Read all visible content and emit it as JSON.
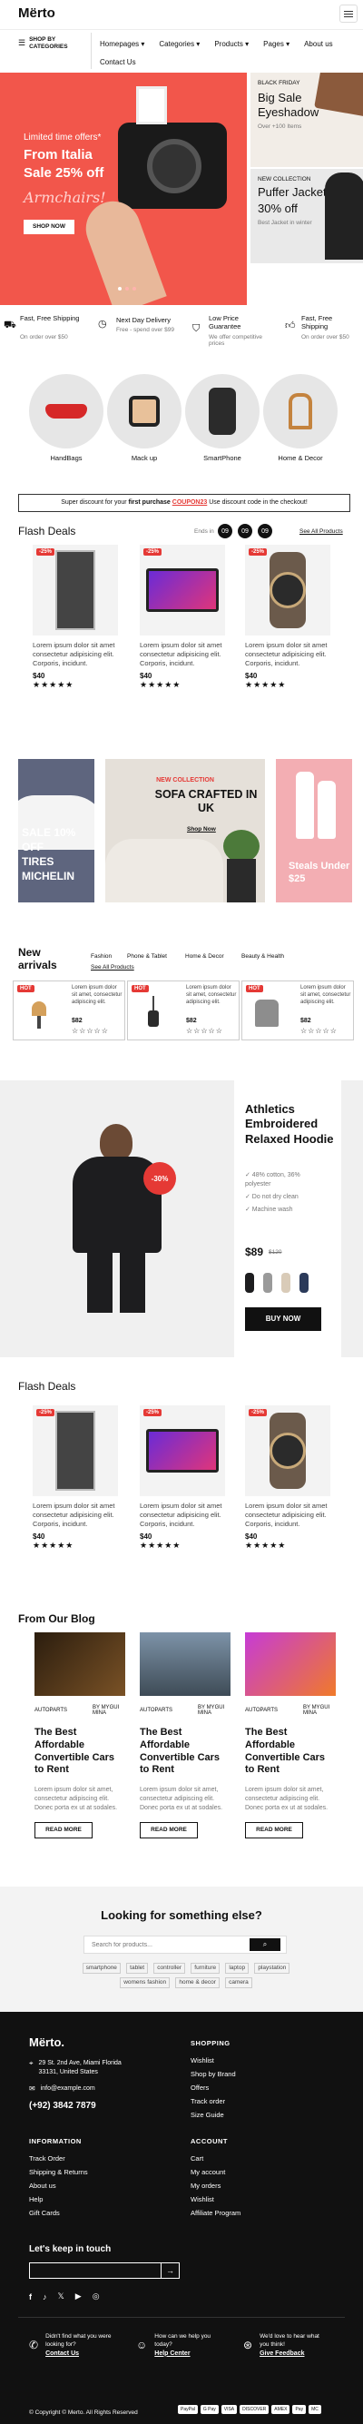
{
  "header": {
    "logo": "Mërto",
    "menu_icon": "hamburger-icon",
    "shop_by": "SHOP BY\nCATEGORIES",
    "nav": [
      "Homepages",
      "Categories",
      "Products",
      "Pages",
      "About us",
      "Contact Us"
    ]
  },
  "hero": {
    "eyebrow": "Limited time offers*",
    "title_line1": "From Italia",
    "title_line2": "Sale 25% off",
    "script": "Armchairs!",
    "cta": "SHOP NOW",
    "side1_eyebrow": "BLACK FRIDAY",
    "side1_title_line1": "Big Sale",
    "side1_title_line2": "Eyeshadow",
    "side1_sub": "Over +100 Items",
    "side2_eyebrow": "NEW COLLECTION",
    "side2_title_line1": "Puffer Jacket",
    "side2_title_line2": "30% off",
    "side2_sub": "Best Jacket in winter",
    "bg_color": "#f2564b"
  },
  "features": [
    {
      "title": "Fast, Free Shipping",
      "sub": "On order over $50",
      "icon": "truck-icon"
    },
    {
      "title": "Next Day Delivery",
      "sub": "Free - spend over $99",
      "icon": "clock-icon"
    },
    {
      "title": "Low Price Guarantee",
      "sub": "We offer competitive prices",
      "icon": "shield-icon"
    },
    {
      "title": "Fast, Free Shipping",
      "sub": "On order over $50",
      "icon": "thumbs-up-icon"
    }
  ],
  "categories": [
    "HandBags",
    "Mack up",
    "SmartPhone",
    "Home & Decor"
  ],
  "coupon": {
    "pre": "Super discount for your ",
    "bold": "first purchase",
    "code": "COUPON23",
    "post": " Use discount code in the checkout!"
  },
  "flash_deals": {
    "title": "Flash Deals",
    "ends_in": "Ends in",
    "timer": [
      "09",
      "09",
      "09"
    ],
    "see_all": "See All Products",
    "products": [
      {
        "discount": "-25%",
        "desc": "Lorem ipsum dolor sit amet consectetur adipisicing elit. Corporis, incidunt.",
        "price": "$40",
        "stars": "★★★★★"
      },
      {
        "discount": "-25%",
        "desc": "Lorem ipsum dolor sit amet consectetur adipisicing elit. Corporis, incidunt.",
        "price": "$40",
        "stars": "★★★★★"
      },
      {
        "discount": "-25%",
        "desc": "Lorem ipsum dolor sit amet consectetur adipisicing elit. Corporis, incidunt.",
        "price": "$40",
        "stars": "★★★★★"
      }
    ]
  },
  "promo": {
    "tires_line1": "SALE 10%",
    "tires_line2": "OFF",
    "tires_line3": "TIRES",
    "tires_line4": "MICHELIN",
    "sofa_eyebrow": "NEW COLLECTION",
    "sofa_title": "SOFA CRAFTED IN UK",
    "sofa_cta": "Shop Now",
    "steals_line1": "Steals Under",
    "steals_line2": "$25"
  },
  "new_arrivals": {
    "title_line1": "New",
    "title_line2": "arrivals",
    "tabs": [
      "Fashion",
      "Phone & Tablet",
      "Home & Decor",
      "Beauty & Health"
    ],
    "see_all": "See All Products",
    "items": [
      {
        "badge": "HOT",
        "desc": "Lorem ipsum dolor sit amet, consectetur adipiscing elit.",
        "price": "$82"
      },
      {
        "badge": "HOT",
        "desc": "Lorem ipsum dolor sit amet, consectetur adipiscing elit.",
        "price": "$82"
      },
      {
        "badge": "HOT",
        "desc": "Lorem ipsum dolor sit amet, consectetur adipiscing elit.",
        "price": "$82"
      }
    ],
    "stars": "☆☆☆☆☆"
  },
  "hoodie": {
    "badge": "-30%",
    "title": "Athletics Embroidered Relaxed Hoodie",
    "features": [
      "✓ 48% cotton, 36% polyester",
      "✓ Do not dry clean",
      "✓ Machine wash"
    ],
    "price": "$89",
    "old_price": "$120",
    "cta": "BUY NOW"
  },
  "flash_deals2": {
    "title": "Flash Deals",
    "products": [
      {
        "discount": "-25%",
        "desc": "Lorem ipsum dolor sit amet consectetur adipisicing elit. Corporis, incidunt.",
        "price": "$40",
        "stars": "★★★★★"
      },
      {
        "discount": "-25%",
        "desc": "Lorem ipsum dolor sit amet consectetur adipisicing elit. Corporis, incidunt.",
        "price": "$40",
        "stars": "★★★★★"
      },
      {
        "discount": "-25%",
        "desc": "Lorem ipsum dolor sit amet consectetur adipisicing elit. Corporis, incidunt.",
        "price": "$40",
        "stars": "★★★★★"
      }
    ]
  },
  "blog": {
    "title": "From Our Blog",
    "posts": [
      {
        "cat": "AUTOPARTS",
        "author_line1": "BY MYGUI",
        "author_line2": "MINA",
        "title": "The Best Affordable Convertible Cars to Rent",
        "excerpt": "Lorem ipsum dolor sit amet, consectetur adipiscing elit. Donec porta ex ut at sodales.",
        "cta": "READ MORE"
      },
      {
        "cat": "AUTOPARTS",
        "author_line1": "BY MYGUI",
        "author_line2": "MINA",
        "title": "The Best Affordable Convertible Cars to Rent",
        "excerpt": "Lorem ipsum dolor sit amet, consectetur adipiscing elit. Donec porta ex ut at sodales.",
        "cta": "READ MORE"
      },
      {
        "cat": "AUTOPARTS",
        "author_line1": "BY MYGUI",
        "author_line2": "MINA",
        "title": "The Best Affordable Convertible Cars to Rent",
        "excerpt": "Lorem ipsum dolor sit amet, consectetur adipiscing elit. Donec porta ex ut at sodales.",
        "cta": "READ MORE"
      }
    ]
  },
  "search": {
    "title": "Looking for something else?",
    "placeholder": "Search for products...",
    "tags": [
      "smartphone",
      "tablet",
      "controller",
      "furniture",
      "laptop",
      "playstation",
      "womens fashion",
      "home & decor",
      "camera"
    ]
  },
  "footer": {
    "logo": "Mërto.",
    "address": "29 St. 2nd Ave, Miami Florida 33131, United States",
    "email": "info@example.com",
    "phone": "(+92) 3842 7879",
    "shopping_h": "SHOPPING",
    "shopping": [
      "Wishlist",
      "Shop by Brand",
      "Offers",
      "Track order",
      "Size Guide"
    ],
    "information_h": "INFORMATION",
    "information": [
      "Track Order",
      "Shipping & Returns",
      "About us",
      "Help",
      "Gift Cards"
    ],
    "account_h": "ACCOUNT",
    "account": [
      "Cart",
      "My account",
      "My orders",
      "Wishlist",
      "Affiliate Program"
    ],
    "keep_in_touch": "Let's keep in touch",
    "help": [
      {
        "line1": "Didn't find what you were",
        "line2": "looking for?",
        "link": "Contact Us",
        "icon": "phone-icon"
      },
      {
        "line1": "How can we help you",
        "line2": "today?",
        "link": "Help Center",
        "icon": "smile-icon"
      },
      {
        "line1": "We'd love to hear what",
        "line2": "you think!",
        "link": "Give Feedback",
        "icon": "feedback-icon"
      }
    ],
    "copyright": "© Copyright © Merto. All Rights Reserved",
    "payments": [
      "PayPal",
      "G Pay",
      "VISA",
      "DISCOVER",
      "AMEX",
      "Pay",
      "MC"
    ]
  }
}
